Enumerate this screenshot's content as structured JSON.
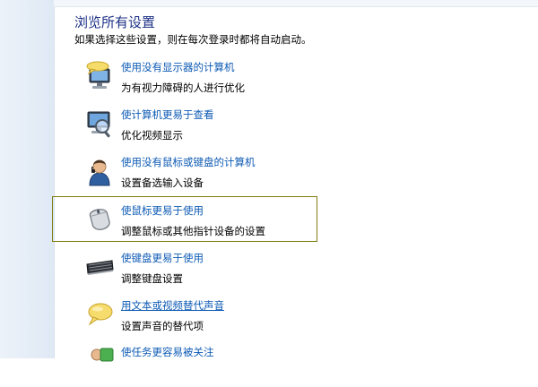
{
  "header": {
    "title": "浏览所有设置",
    "subtitle": "如果选择这些设置，则在每次登录时都将自动启动。"
  },
  "options": [
    {
      "icon": "monitor-speech-icon",
      "link": "使用没有显示器的计算机",
      "desc": "为有视力障碍的人进行优化"
    },
    {
      "icon": "magnifier-monitor-icon",
      "link": "使计算机更易于查看",
      "desc": "优化视频显示"
    },
    {
      "icon": "user-person-icon",
      "link": "使用没有鼠标或键盘的计算机",
      "desc": "设置备选输入设备"
    },
    {
      "icon": "mouse-icon",
      "link": "使鼠标更易于使用",
      "desc": "调整鼠标或其他指针设备的设置",
      "selected": true
    },
    {
      "icon": "keyboard-icon",
      "link": "使键盘更易于使用",
      "desc": "调整键盘设置"
    },
    {
      "icon": "speech-bubble-icon",
      "link": "用文本或视频替代声音",
      "desc": "设置声音的替代项",
      "hovered": true
    },
    {
      "icon": "task-focus-icon",
      "link": "使任务更容易被关注",
      "desc": ""
    }
  ],
  "colors": {
    "link": "#0d5ab4",
    "title": "#1e3287",
    "selection_border": "#7f7d10",
    "sidebar": "#dfe9f5"
  }
}
